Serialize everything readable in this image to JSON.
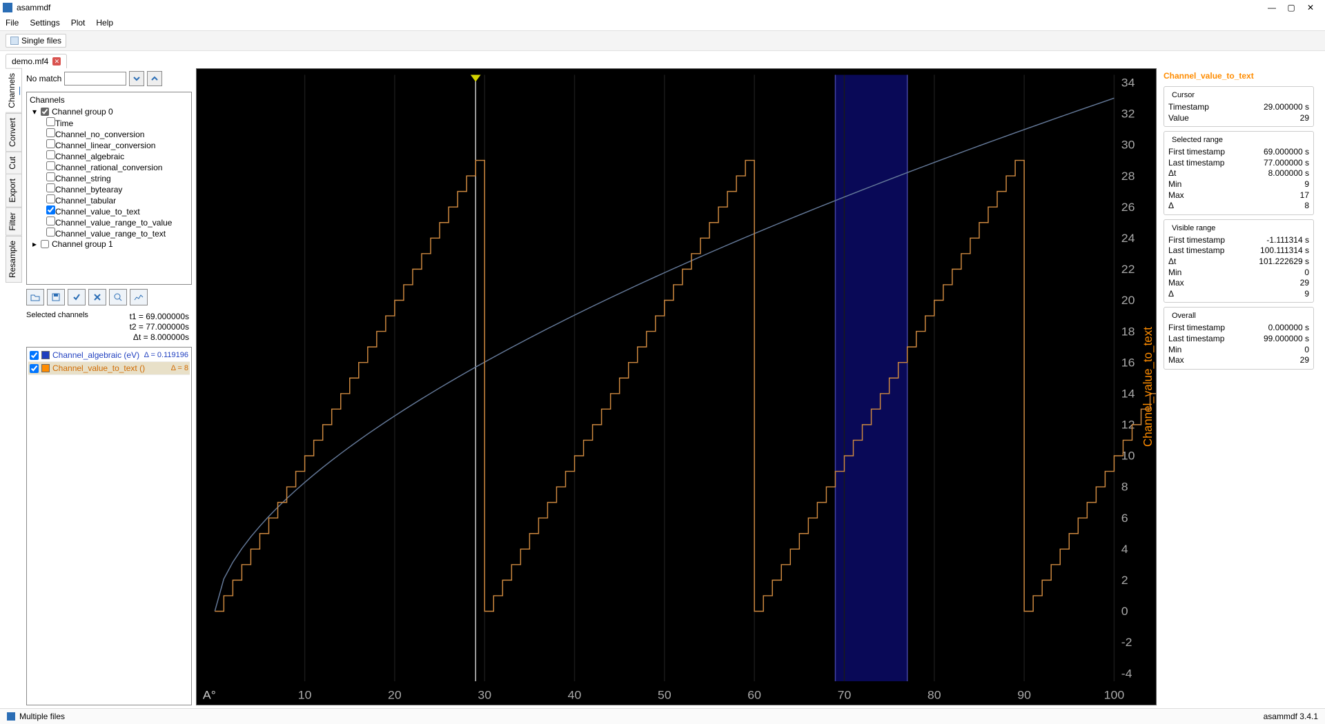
{
  "app": {
    "title": "asammdf",
    "version": "asammdf 3.4.1"
  },
  "menu": {
    "file": "File",
    "settings": "Settings",
    "plot": "Plot",
    "help": "Help"
  },
  "mode_tab": "Single files",
  "file_tab": "demo.mf4",
  "side_tabs": [
    "Channels",
    "Convert",
    "Cut",
    "Export",
    "Filter",
    "Resample"
  ],
  "search": {
    "no_match": "No match"
  },
  "tree": {
    "header": "Channels",
    "group0": "Channel group 0",
    "group1": "Channel group 1",
    "items": [
      "Time",
      "Channel_no_conversion",
      "Channel_linear_conversion",
      "Channel_algebraic",
      "Channel_rational_conversion",
      "Channel_string",
      "Channel_bytearay",
      "Channel_tabular",
      "Channel_value_to_text",
      "Channel_value_range_to_value",
      "Channel_value_range_to_text"
    ],
    "checked_index": 8
  },
  "time_stats": {
    "t1": "t1 = 69.000000s",
    "t2": "t2 = 77.000000s",
    "dt": "Δt = 8.000000s"
  },
  "selected_channels": {
    "label": "Selected channels",
    "rows": [
      {
        "color": "#1f3fbf",
        "name": "Channel_algebraic (eV)",
        "delta": "Δ = 0.119196"
      },
      {
        "color": "#ff8c00",
        "name": "Channel_value_to_text ()",
        "delta": "Δ = 8"
      }
    ]
  },
  "right": {
    "title": "Channel_value_to_text",
    "cursor": {
      "hdr": "Cursor",
      "Timestamp": "29.000000 s",
      "Value": "29"
    },
    "selected": {
      "hdr": "Selected range",
      "First timestamp": "69.000000 s",
      "Last timestamp": "77.000000 s",
      "Δt": "8.000000 s",
      "Min": "9",
      "Max": "17",
      "Δ": "8"
    },
    "visible": {
      "hdr": "Visible range",
      "First timestamp": "-1.111314 s",
      "Last timestamp": "100.111314 s",
      "Δt": "101.222629 s",
      "Min": "0",
      "Max": "29",
      "Δ": "9"
    },
    "overall": {
      "hdr": "Overall",
      "First timestamp": "0.000000 s",
      "Last timestamp": "99.000000 s",
      "Min": "0",
      "Max": "29"
    }
  },
  "statusbar": {
    "multiple": "Multiple files"
  },
  "chart_data": {
    "type": "line",
    "xlabel": "",
    "ylabel": "Channel_value_to_text",
    "xlim": [
      -1.11,
      100.11
    ],
    "ylim": [
      -4.5,
      34.5
    ],
    "x_ticks": [
      10,
      20,
      30,
      40,
      50,
      60,
      70,
      80,
      90,
      100
    ],
    "y_ticks": [
      -4,
      -2,
      0,
      2,
      4,
      6,
      8,
      10,
      12,
      14,
      16,
      18,
      20,
      22,
      24,
      26,
      28,
      30,
      32,
      34
    ],
    "series": [
      {
        "name": "Channel_algebraic",
        "color": "#657a9a",
        "approx": "monotone_curve 0→33 over 0→100"
      },
      {
        "name": "Channel_value_to_text",
        "color": "#d08a40",
        "approx": "repeating integer staircase 0..29 step 1, period 30s, 4 periods"
      }
    ],
    "cursor_x": 29,
    "selection": {
      "x0": 69,
      "x1": 77
    }
  }
}
